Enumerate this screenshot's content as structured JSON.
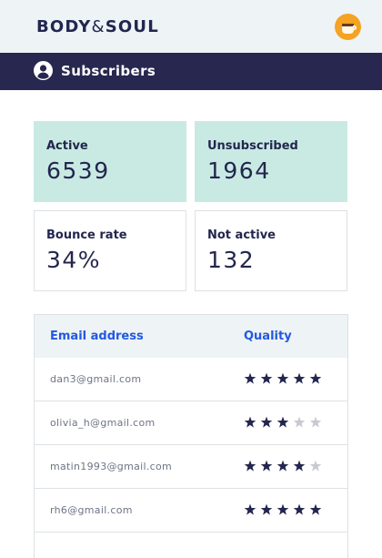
{
  "header": {
    "brand_left": "BODY",
    "brand_amp": "&",
    "brand_right": "SOUL"
  },
  "nav": {
    "title": "Subscribers"
  },
  "stats": {
    "active": {
      "label": "Active",
      "value": "6539"
    },
    "unsubscribed": {
      "label": "Unsubscribed",
      "value": "1964"
    },
    "bounce_rate": {
      "label": "Bounce rate",
      "value": "34%"
    },
    "not_active": {
      "label": "Not active",
      "value": "132"
    }
  },
  "table": {
    "headers": {
      "email": "Email address",
      "quality": "Quality"
    },
    "max_stars": 5,
    "rows": [
      {
        "email": "dan3@gmail.com",
        "quality": 5
      },
      {
        "email": "olivia_h@gmail.com",
        "quality": 3
      },
      {
        "email": "matin1993@gmail.com",
        "quality": 4
      },
      {
        "email": "rh6@gmail.com",
        "quality": 5
      }
    ]
  },
  "colors": {
    "navy": "#27274f",
    "accent_blue": "#2159e0",
    "mint": "#c8eae3",
    "star_filled": "#23264e",
    "star_empty": "#c7cad1"
  }
}
